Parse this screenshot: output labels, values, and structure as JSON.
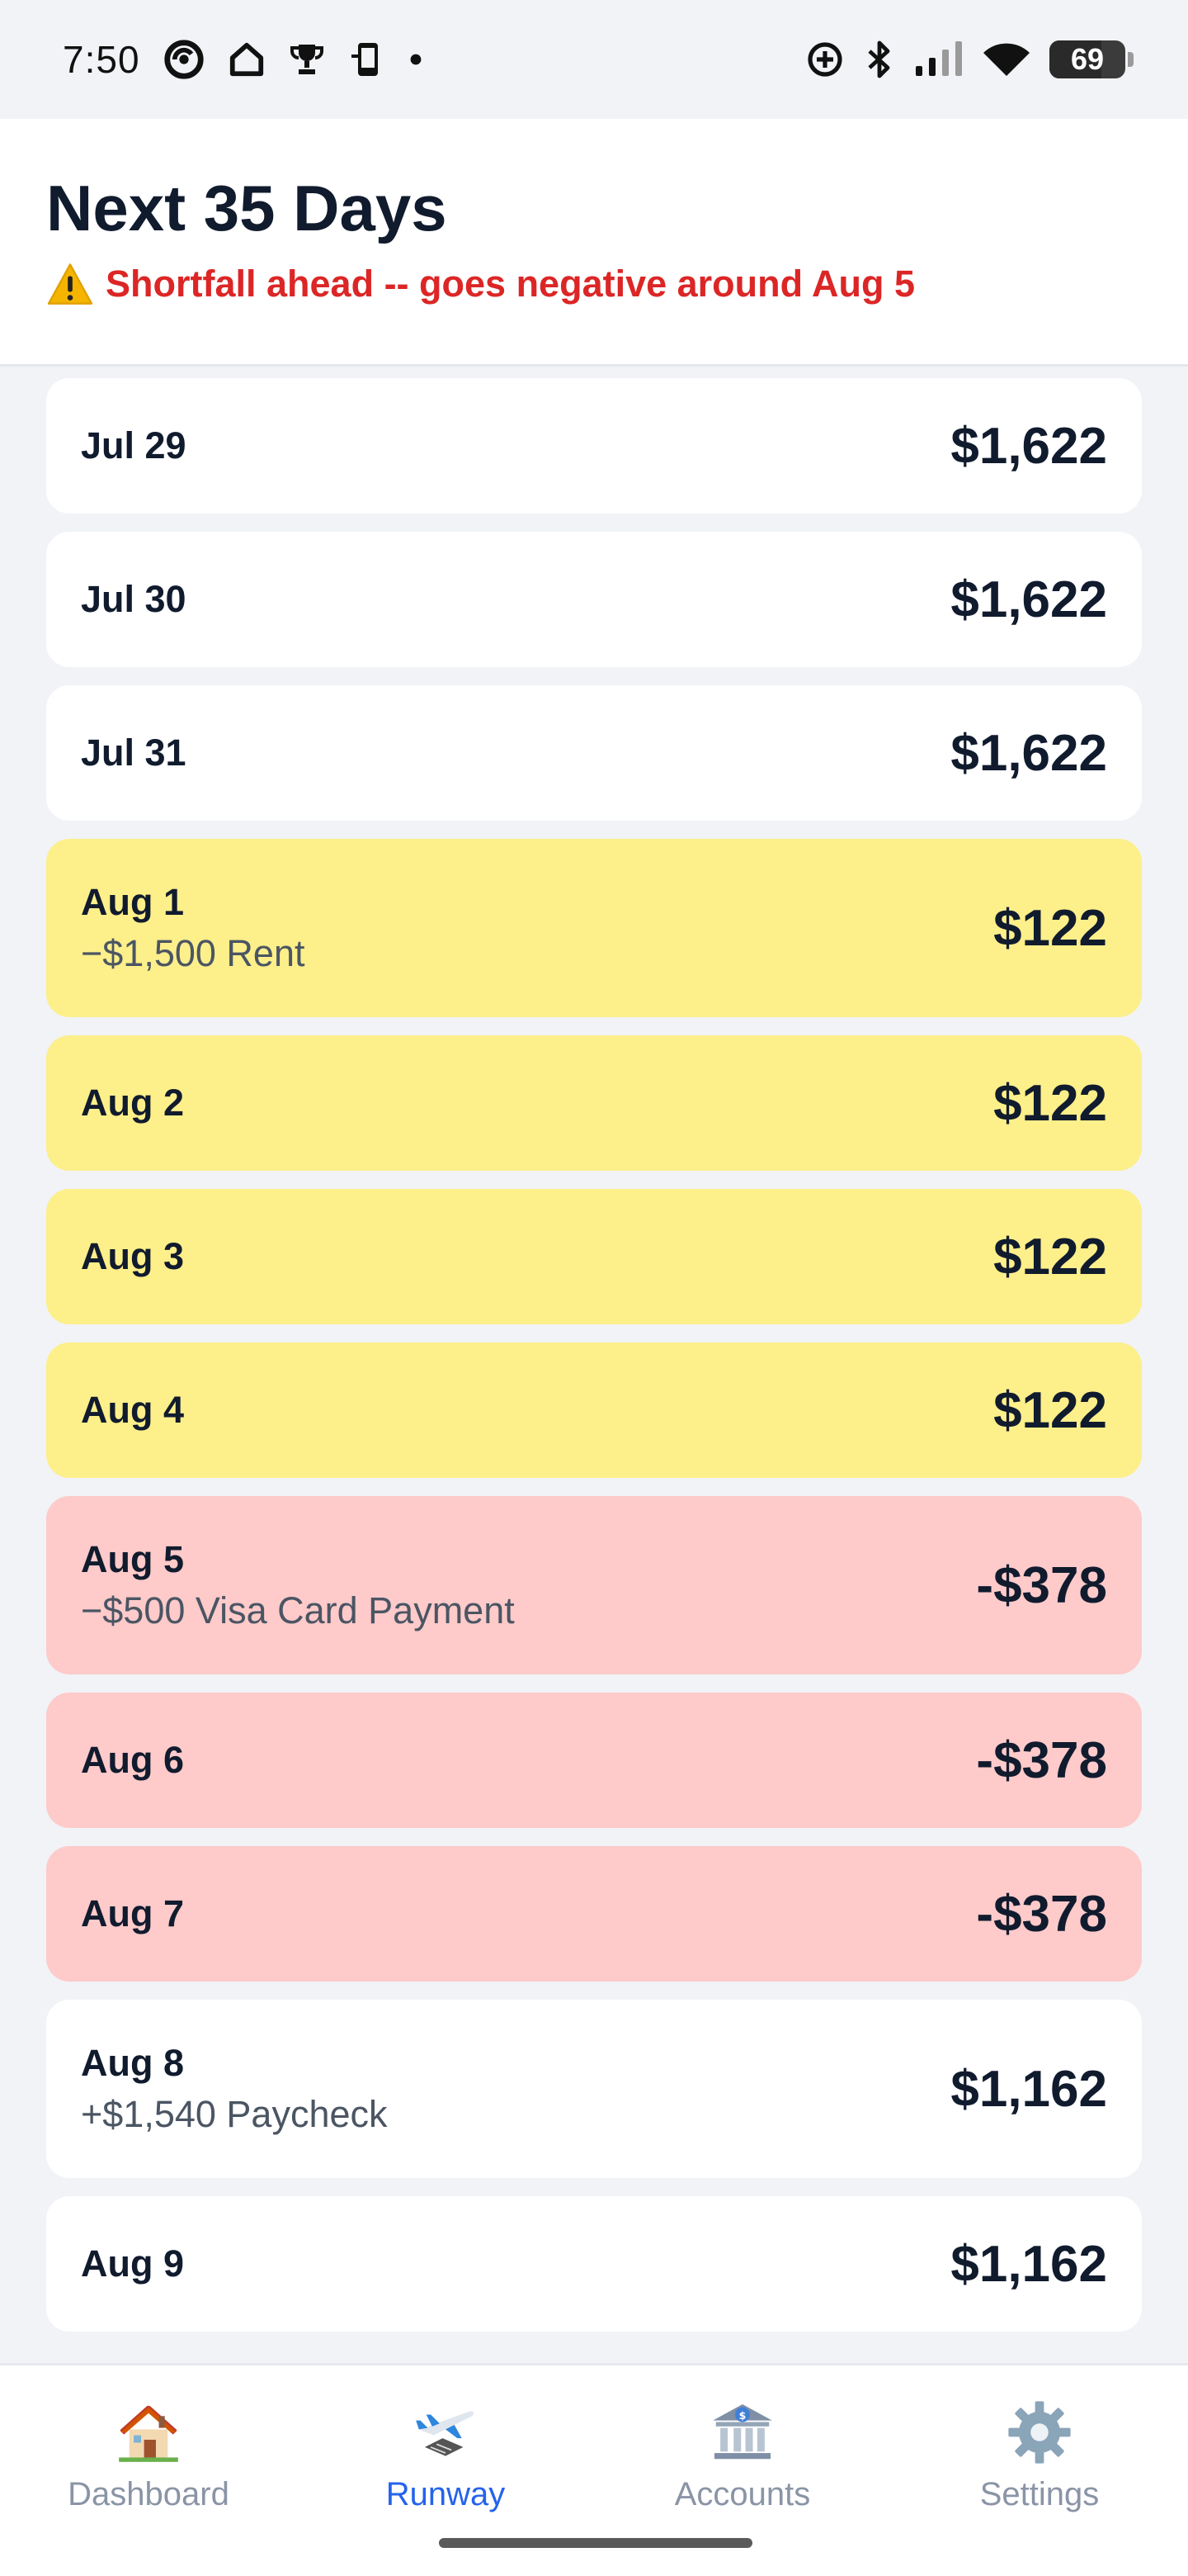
{
  "status_bar": {
    "time": "7:50",
    "battery_percent": "69",
    "battery_level": 0.69,
    "left_icons": [
      "sync-icon",
      "home-outline-icon",
      "trophy-icon",
      "phone-icon",
      "dot-icon"
    ],
    "right_icons": [
      "data-saver-icon",
      "bluetooth-icon",
      "signal-icon",
      "wifi-icon",
      "battery-icon"
    ]
  },
  "header": {
    "title": "Next 35 Days",
    "warning_icon": "warning-icon",
    "warning_text": "Shortfall ahead -- goes negative around Aug 5",
    "warning_color": "#dc2626"
  },
  "days": [
    {
      "date": "Jul 29",
      "note": "",
      "balance": "$1,622",
      "status": "ok"
    },
    {
      "date": "Jul 30",
      "note": "",
      "balance": "$1,622",
      "status": "ok"
    },
    {
      "date": "Jul 31",
      "note": "",
      "balance": "$1,622",
      "status": "ok"
    },
    {
      "date": "Aug 1",
      "note": "−$1,500 Rent",
      "balance": "$122",
      "status": "low"
    },
    {
      "date": "Aug 2",
      "note": "",
      "balance": "$122",
      "status": "low"
    },
    {
      "date": "Aug 3",
      "note": "",
      "balance": "$122",
      "status": "low"
    },
    {
      "date": "Aug 4",
      "note": "",
      "balance": "$122",
      "status": "low"
    },
    {
      "date": "Aug 5",
      "note": "−$500 Visa Card Payment",
      "balance": "-$378",
      "status": "negative"
    },
    {
      "date": "Aug 6",
      "note": "",
      "balance": "-$378",
      "status": "negative"
    },
    {
      "date": "Aug 7",
      "note": "",
      "balance": "-$378",
      "status": "negative"
    },
    {
      "date": "Aug 8",
      "note": "+$1,540 Paycheck",
      "balance": "$1,162",
      "status": "ok"
    },
    {
      "date": "Aug 9",
      "note": "",
      "balance": "$1,162",
      "status": "ok"
    }
  ],
  "colors": {
    "ok": "#ffffff",
    "low": "#fdef8a",
    "negative": "#fecaca",
    "accent": "#2563eb"
  },
  "nav": [
    {
      "label": "Dashboard",
      "icon": "house-icon",
      "active": false
    },
    {
      "label": "Runway",
      "icon": "airplane-icon",
      "active": true
    },
    {
      "label": "Accounts",
      "icon": "bank-icon",
      "active": false
    },
    {
      "label": "Settings",
      "icon": "gear-icon",
      "active": false
    }
  ]
}
